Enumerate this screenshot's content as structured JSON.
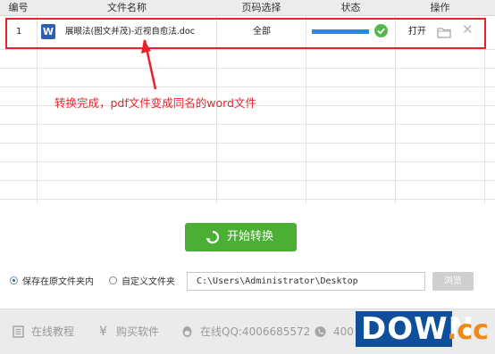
{
  "header": {
    "col_num": "编号",
    "col_filename": "文件名称",
    "col_pages": "页码选择",
    "col_status": "状态",
    "col_action": "操作"
  },
  "rows": [
    {
      "num": "1",
      "file_icon": "word-doc-icon",
      "file_icon_letter": "W",
      "filename": "展眼法(图文并茂)-近视自愈法.doc",
      "pages": "全部",
      "progress": 1.0,
      "status_icon": "check-icon",
      "open_label": "打开",
      "folder_icon": "folder-icon",
      "delete_icon": "close-icon"
    }
  ],
  "annotation": "转换完成，pdf文件变成同名的word文件",
  "start_button": {
    "label": "开始转换",
    "icon": "refresh-icon"
  },
  "output": {
    "option_original": "保存在原文件夹内",
    "option_custom": "自定义文件夹",
    "selected": "original",
    "path": "C:\\Users\\Administrator\\Desktop",
    "browse_label": "浏览"
  },
  "footer": {
    "tutorial": "在线教程",
    "buy": "购买软件",
    "qq": "在线QQ:4006685572",
    "phone": "400"
  },
  "watermark": {
    "main": "DOWN",
    "suffix": ".cc"
  },
  "colors": {
    "accent_red": "#e8232d",
    "start_green": "#4caf35",
    "progress_blue": "#1e8fd8",
    "check_green": "#55b84a",
    "logo_blue": "#0f4f9a",
    "logo_orange": "#f08a17"
  }
}
